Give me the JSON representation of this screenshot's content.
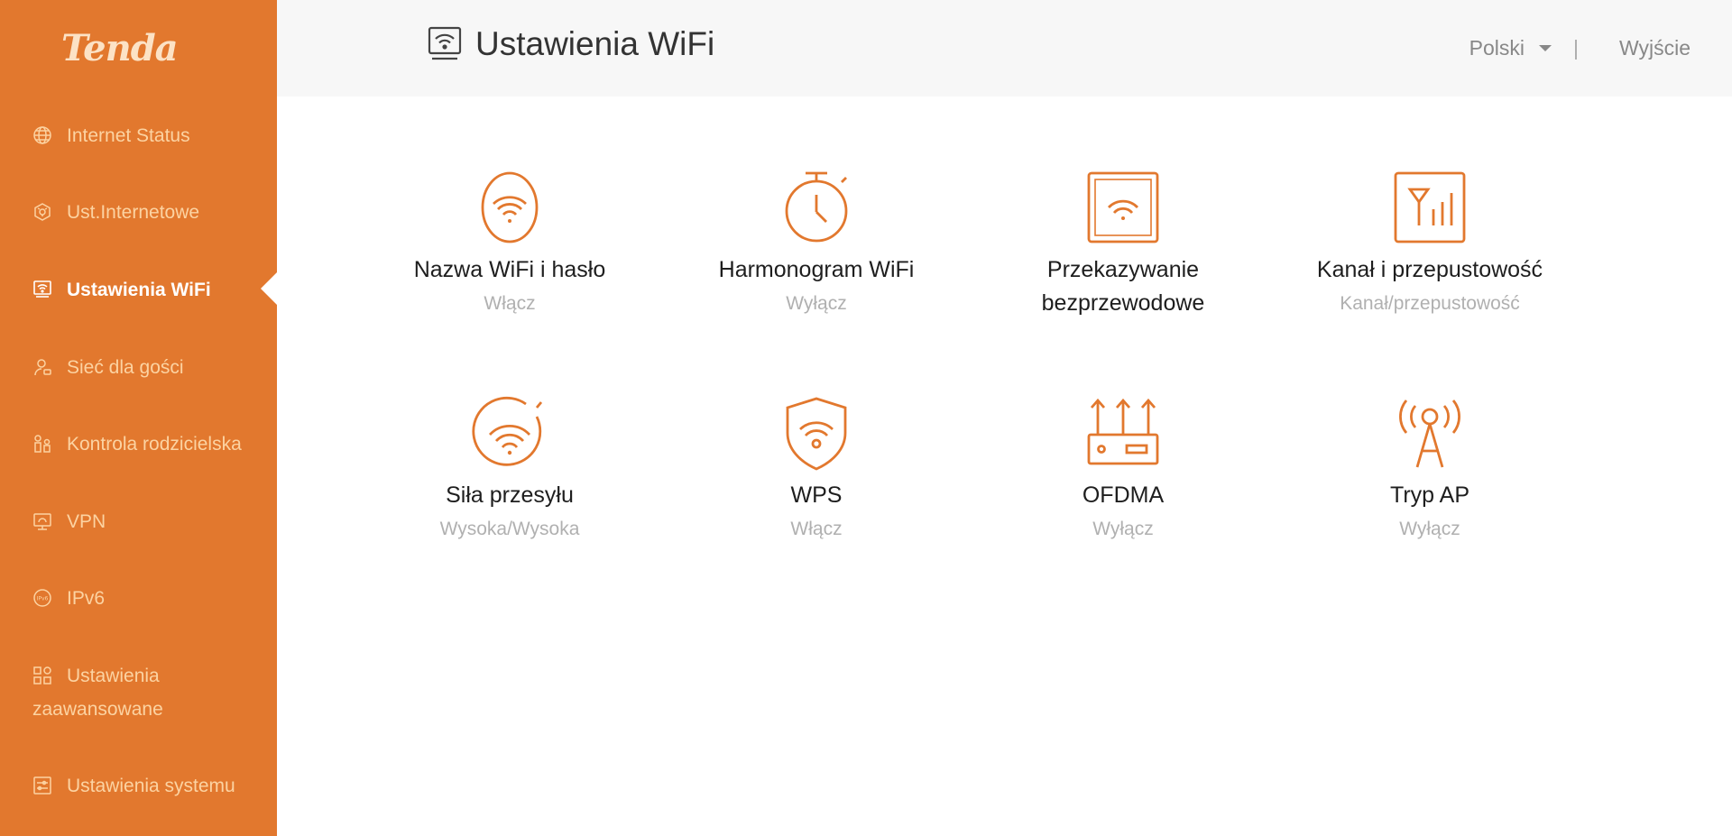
{
  "brand": {
    "logo_text": "Tenda",
    "accent": "#e2782e"
  },
  "header": {
    "title": "Ustawienia WiFi",
    "title_icon": "router-wifi-icon",
    "language": "Polski",
    "divider": "|",
    "logout": "Wyjście"
  },
  "sidebar": {
    "items": [
      {
        "label": "Internet Status",
        "icon": "globe-icon"
      },
      {
        "label": "Ust.Internetowe",
        "icon": "network-hex-icon"
      },
      {
        "label": "Ustawienia WiFi",
        "icon": "router-wifi-icon",
        "active": true
      },
      {
        "label": "Sieć dla gości",
        "icon": "guest-user-icon"
      },
      {
        "label": "Kontrola rodzicielska",
        "icon": "family-icon"
      },
      {
        "label": "VPN",
        "icon": "vpn-monitor-icon"
      },
      {
        "label": "IPv6",
        "icon": "ipv6-icon"
      },
      {
        "label": "Ustawienia zaawansowane",
        "icon": "grid-icon"
      },
      {
        "label": "Ustawienia systemu",
        "icon": "system-settings-icon"
      }
    ]
  },
  "tiles": [
    {
      "title": "Nazwa WiFi i hasło",
      "status": "Włącz",
      "icon": "wifi-oval-icon"
    },
    {
      "title": "Harmonogram WiFi",
      "status": "Wyłącz",
      "icon": "stopwatch-icon"
    },
    {
      "title": "Przekazywanie bezprzewodowe",
      "status": "",
      "icon": "wifi-square-icon"
    },
    {
      "title": "Kanał i przepustowość",
      "status": "Kanał/przepustowość",
      "icon": "channel-bars-icon"
    },
    {
      "title": "Siła przesyłu",
      "status": "Wysoka/Wysoka",
      "icon": "wifi-circle-icon"
    },
    {
      "title": "WPS",
      "status": "Włącz",
      "icon": "wifi-shield-icon"
    },
    {
      "title": "OFDMA",
      "status": "Wyłącz",
      "icon": "router-arrows-icon"
    },
    {
      "title": "Tryp AP",
      "status": "Wyłącz",
      "icon": "antenna-icon"
    }
  ]
}
